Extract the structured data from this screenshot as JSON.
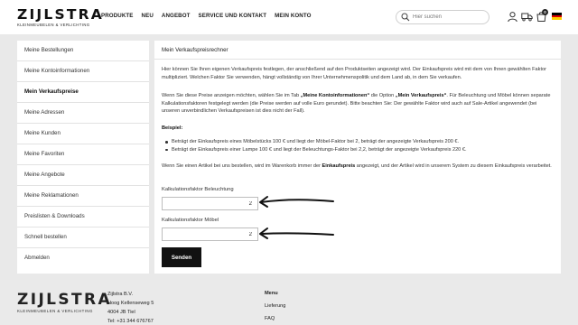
{
  "header": {
    "logo_main": "ZIJLSTRA",
    "logo_sub": "KLEINMEUBELEN & VERLICHTING",
    "nav": [
      "PRODUKTE",
      "NEU",
      "ANGEBOT",
      "SERVICE UND KONTAKT",
      "MEIN KONTO"
    ],
    "search_placeholder": "Hier suchen",
    "cart_count": "0",
    "icons": [
      "search-icon",
      "user-icon",
      "truck-icon",
      "cart-icon",
      "german-flag-icon"
    ]
  },
  "sidebar": {
    "items": [
      "Meine Bestellungen",
      "Meine Kontoinformationen",
      "Mein Verkaufspreise",
      "Meine Adressen",
      "Meine Kunden",
      "Meine Favoriten",
      "Meine Angebote",
      "Meine Reklamationen",
      "Preislisten & Downloads",
      "Schnell bestellen",
      "Abmelden"
    ],
    "active": "Mein Verkaufspreise"
  },
  "main": {
    "title": "Mein Verkaufspreisrechner",
    "intro": "Hier können Sie Ihren eigenen Verkaufspreis festlegen, der anschließend auf den Produktseiten angezeigt wird. Der Einkaufspreis wird mit dem von Ihnen gewählten Faktor multipliziert. Welchen Faktor Sie verwenden, hängt vollständig von Ihrer Unternehmenspolitik und dem Land ab, in dem Sie verkaufen.",
    "para2_a": "Wenn Sie diese Preise anzeigen möchten, wählen Sie im Tab ",
    "para2_b": "„Meine Kontoinformationen“",
    "para2_c": " die Option ",
    "para2_d": "„Mein Verkaufspreis“",
    "para2_e": ". Für Beleuchtung und Möbel können separate Kalkulationsfaktoren festgelegt werden (die Preise werden auf volle Euro gerundet). Bitte beachten Sie: Der gewählte Faktor wird auch auf Sale-Artikel angewendet (bei unseren unverbindlichen Verkaufspreisen ist dies nicht der Fall).",
    "example_label": "Beispiel:",
    "examples": [
      "Beträgt der Einkaufspreis eines Möbelstücks 100 € und liegt der Möbel-Faktor bei 2, beträgt der angezeigte Verkaufspreis 200 €.",
      "Beträgt der Einkaufspreis einer Lampe 100 € und liegt der Beleuchtungs-Faktor bei 2,2, beträgt der angezeigte Verkaufspreis 220 €."
    ],
    "para3_a": "Wenn Sie einen Artikel bei uns bestellen, wird im Warenkorb immer der ",
    "para3_b": "Einkaufspreis",
    "para3_c": " angezeigt, und der Artikel wird in unserem System zu diesem Einkaufspreis verarbeitet.",
    "field1_label": "Kalkulationsfaktor Beleuchtung",
    "field1_value": "2",
    "field2_label": "Kalkulationsfaktor Möbel",
    "field2_value": "2",
    "submit_label": "Senden"
  },
  "footer": {
    "logo_main": "ZIJLSTRA",
    "logo_sub": "KLEINMEUBELEN & VERLICHTING",
    "company": "Zijlstra B.V.",
    "street": "Hoog Kellenseweg 5",
    "city": "4004 JB Tiel",
    "phone": "Tel: +31 344 676767",
    "menu_title": "Menu",
    "menu_items": [
      "Lieferung",
      "FAQ"
    ]
  },
  "colors": {
    "accent": "#111111",
    "page_bg": "#e9e9e9"
  }
}
